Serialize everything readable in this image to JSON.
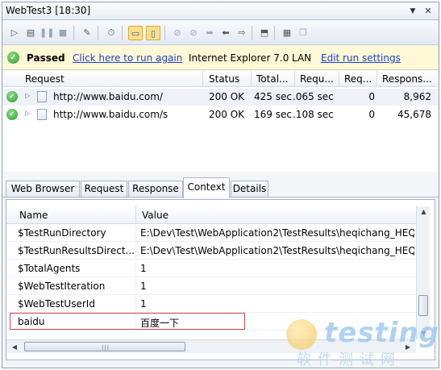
{
  "window": {
    "title": "WebTest3 [18:30]"
  },
  "toolbar": {
    "icons": [
      "run-icon",
      "record-icon",
      "pause-icon",
      "stop-icon",
      "edit-icon",
      "timing-icon",
      "tile-horizontal-icon",
      "tile-vertical-icon",
      "disabled-icon",
      "disabled-icon",
      "forward-icon",
      "back-icon",
      "export-icon",
      "settings-icon",
      "copy-icon"
    ]
  },
  "status": {
    "state": "Passed",
    "run_again_link": "Click here to run again",
    "browser": "Internet Explorer 7.0",
    "network": "LAN",
    "edit_settings_link": "Edit run settings"
  },
  "request_grid": {
    "columns": [
      "Request",
      "Status",
      "Total...",
      "Requ...",
      "Req...",
      "Respons..."
    ],
    "rows": [
      {
        "url": "http://www.baidu.com/",
        "status": "200 OK",
        "total": "425 sec",
        "requ": ".065 sec",
        "req": "0",
        "response": "8,962"
      },
      {
        "url": "http://www.baidu.com/s",
        "status": "200 OK",
        "total": "169 sec",
        "requ": ".108 sec",
        "req": "0",
        "response": "45,678"
      }
    ]
  },
  "tabs": [
    "Web Browser",
    "Request",
    "Response",
    "Context",
    "Details"
  ],
  "active_tab": "Context",
  "context": {
    "columns": [
      "Name",
      "Value"
    ],
    "rows": [
      {
        "name": "$TestRunDirectory",
        "value": "E:\\Dev\\Test\\WebApplication2\\TestResults\\heqichang_HEQ"
      },
      {
        "name": "$TestRunResultsDirect...",
        "value": "E:\\Dev\\Test\\WebApplication2\\TestResults\\heqichang_HEQ"
      },
      {
        "name": "$TotalAgents",
        "value": "1"
      },
      {
        "name": "$WebTestIteration",
        "value": "1"
      },
      {
        "name": "$WebTestUserId",
        "value": "1"
      },
      {
        "name": "baidu",
        "value": "百度一下"
      }
    ],
    "highlighted_row": "baidu"
  },
  "watermark": {
    "word": "testing",
    "sub": "软件测试网"
  },
  "colors": {
    "link": "#1a3fd6",
    "status_bg": "#fff8d6",
    "highlight_border": "#d9444a",
    "pass_green": "#2f9a2a"
  }
}
